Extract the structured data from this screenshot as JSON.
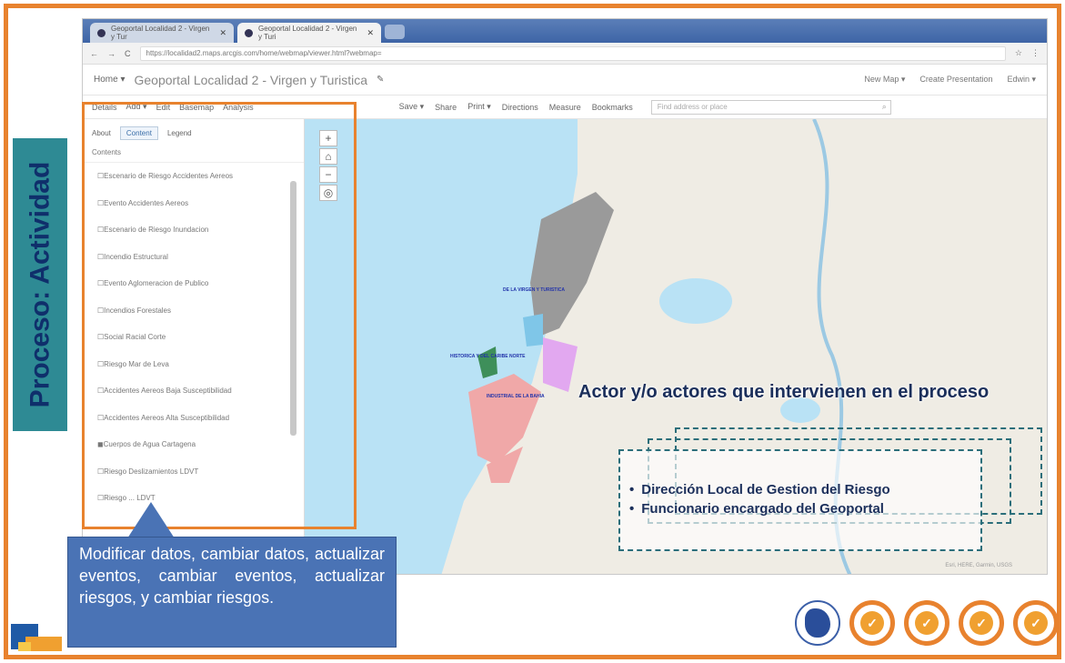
{
  "slide": {
    "side_title": "Proceso:  Actividad",
    "actors_title": "Actor y/o actores que intervienen en el proceso",
    "actors": [
      "Dirección Local de Gestion del Riesgo",
      "Funcionario  encargado del Geoportal"
    ],
    "callout": "Modificar datos, cambiar datos, actualizar eventos, cambiar eventos, actualizar riesgos, y cambiar riesgos."
  },
  "browser": {
    "tabs": [
      {
        "label": "Geoportal Localidad 2 - Virgen y Tur"
      },
      {
        "label": "Geoportal Localidad 2 - Virgen y Turi"
      }
    ],
    "url": "https://localidad2.maps.arcgis.com/home/webmap/viewer.html?webmap="
  },
  "app": {
    "home_label": "Home ▾",
    "map_title": "Geoportal Localidad 2 - Virgen y Turistica",
    "header_links": [
      "New Map ▾",
      "Create Presentation",
      "Edwin ▾"
    ],
    "left_tools": [
      "Details",
      "Add ▾",
      "Edit",
      "Basemap",
      "Analysis"
    ],
    "right_tools": [
      "Save ▾",
      "Share",
      "Print ▾",
      "Directions",
      "Measure",
      "Bookmarks"
    ],
    "search_placeholder": "Find address or place"
  },
  "panel": {
    "tabs": [
      "About",
      "Content",
      "Legend"
    ],
    "heading": "Contents",
    "layers": [
      "Escenario de Riesgo Accidentes Aereos",
      "Evento Accidentes Aereos",
      "Escenario de Riesgo Inundacion",
      "Incendio Estructural",
      "Evento Aglomeracion de Publico",
      "Incendios Forestales",
      "Social Racial Corte",
      "Riesgo Mar de Leva",
      "Accidentes Aereos Baja Susceptibilidad",
      "Accidentes Aereos Alta Susceptibilidad",
      "Cuerpos de Agua Cartagena",
      "Riesgo Deslizamientos LDVT",
      "Riesgo ... LDVT"
    ]
  },
  "map": {
    "labels": [
      "DE LA VIRGEN Y TURISTICA",
      "HISTORICA Y DEL CARIBE NORTE",
      "INDUSTRIAL DE LA BAHIA"
    ],
    "attribution": "Esri, HERE, Garmin, USGS"
  },
  "colors": {
    "accent_orange": "#e8822e",
    "side_tab": "#2e8a94",
    "callout_blue": "#4a73b5",
    "title_navy": "#1b2f5b"
  }
}
